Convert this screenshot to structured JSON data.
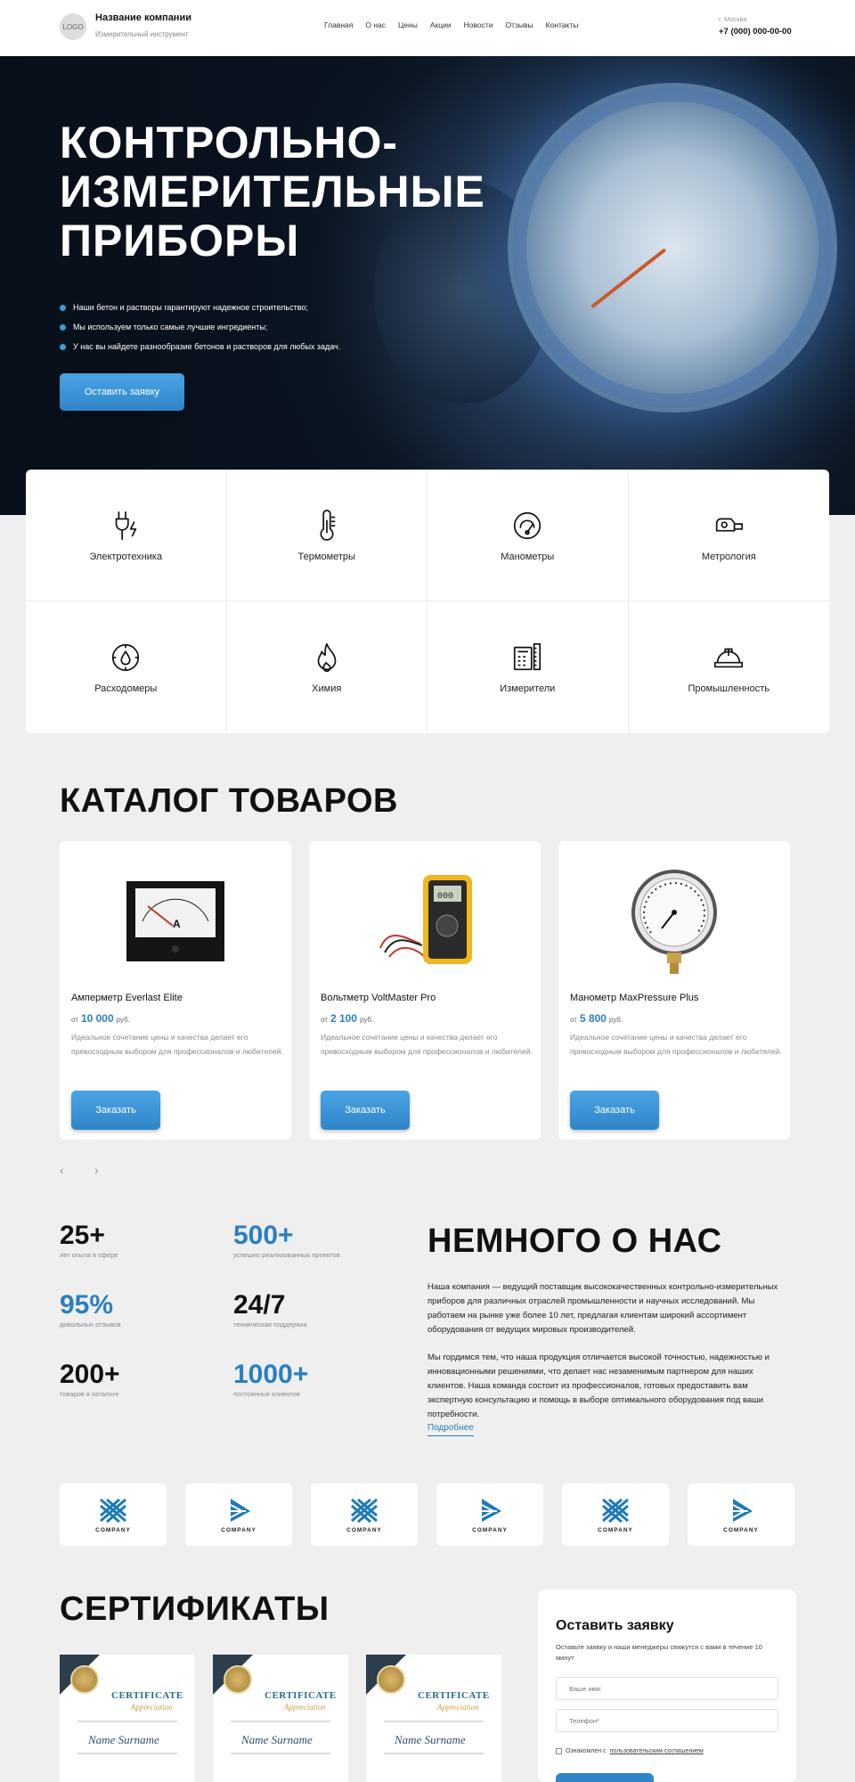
{
  "header": {
    "logo": "LOGO",
    "company": "Название компании",
    "tagline": "Измерительный инструмент",
    "nav": [
      "Главная",
      "О нас",
      "Цены",
      "Акции",
      "Новости",
      "Отзывы",
      "Контакты"
    ],
    "city": "г. Москва",
    "phone": "+7 (000) 000-00-00"
  },
  "hero": {
    "title": "КОНТРОЛЬНО-ИЗМЕРИТЕЛЬНЫЕ ПРИБОРЫ",
    "bullets": [
      "Наши бетон и растворы гарантируют надежное строительство;",
      "Мы используем только самые лучшие ингредиенты;",
      "У нас вы найдете разнообразие бетонов и растворов для любых задач."
    ],
    "button": "Оставить заявку"
  },
  "categories": [
    {
      "label": "Электротехника",
      "icon": "plug-lightning-icon"
    },
    {
      "label": "Термометры",
      "icon": "thermometer-icon"
    },
    {
      "label": "Манометры",
      "icon": "gauge-icon"
    },
    {
      "label": "Метрология",
      "icon": "tape-measure-icon"
    },
    {
      "label": "Расходомеры",
      "icon": "flowmeter-icon"
    },
    {
      "label": "Химия",
      "icon": "flame-icon"
    },
    {
      "label": "Измерители",
      "icon": "calculator-ruler-icon"
    },
    {
      "label": "Промышленность",
      "icon": "hard-hat-icon"
    }
  ],
  "catalog": {
    "title": "КАТАЛОГ ТОВАРОВ",
    "products": [
      {
        "name": "Амперметр Everlast Elite",
        "from": "от",
        "price": "10 000",
        "currency": "руб.",
        "desc": "Идеальное сочетание цены и качества делает его превосходным выбором для профессионалов и любителей.",
        "button": "Заказать"
      },
      {
        "name": "Вольтметр VoltMaster Pro",
        "from": "от",
        "price": "2 100",
        "currency": "руб.",
        "desc": "Идеальное сочетание цены и качества делает его превосходным выбором для профессионалов и любителей.",
        "button": "Заказать"
      },
      {
        "name": "Манометр MaxPressure Plus",
        "from": "от",
        "price": "5 800",
        "currency": "руб.",
        "desc": "Идеальное сочетание цены и качества делает его превосходным выбором для профессионалов и любителей.",
        "button": "Заказать"
      }
    ],
    "prev": "‹",
    "next": "›"
  },
  "stats": [
    {
      "value": "25+",
      "label": "лет опыта в сфере",
      "accent": false
    },
    {
      "value": "500+",
      "label": "успешно реализованных проектов",
      "accent": true
    },
    {
      "value": "95%",
      "label": "довольных отзывов",
      "accent": true
    },
    {
      "value": "24/7",
      "label": "техническая поддержка",
      "accent": false
    },
    {
      "value": "200+",
      "label": "товаров в каталоге",
      "accent": false
    },
    {
      "value": "1000+",
      "label": "постоянных клиентов",
      "accent": true
    }
  ],
  "about": {
    "title": "НЕМНОГО О НАС",
    "p1": "Наша компания — ведущий поставщик высококачественных контрольно-измерительных приборов для различных отраслей промышленности и научных исследований. Мы работаем на рынке уже более 10 лет, предлагая клиентам широкий ассортимент оборудования от ведущих мировых производителей.",
    "p2": "Мы гордимся тем, что наша продукция отличается высокой точностью, надежностью и инновационными решениями, что делает нас незаменимым партнером для наших клиентов. Наша команда состоит из профессионалов, готовых предоставить вам экспертную консультацию и помощь в выборе оптимального оборудования под ваши потребности.",
    "more": "Подробнее"
  },
  "partners": [
    "COMPANY",
    "COMPANY",
    "COMPANY",
    "COMPANY",
    "COMPANY",
    "COMPANY"
  ],
  "certificates": {
    "title": "СЕРТИФИКАТЫ",
    "items": [
      {
        "heading": "CERTIFICATE",
        "sub": "Appreciation",
        "name": "Name Surname"
      },
      {
        "heading": "CERTIFICATE",
        "sub": "Appreciation",
        "name": "Name Surname"
      },
      {
        "heading": "CERTIFICATE",
        "sub": "Appreciation",
        "name": "Name Surname"
      }
    ]
  },
  "form": {
    "title": "Оставить заявку",
    "subtitle": "Оставьте заявку и наши менеджеры свяжутся с вами в течение 10 минут",
    "name_placeholder": "Ваше имя:",
    "phone_placeholder": "Телефон*",
    "consent_prefix": "Ознакомлен с ",
    "consent_link": "пользовательским соглашением"
  },
  "colors": {
    "accent": "#2f85c8",
    "page_bg": "#efefef"
  }
}
